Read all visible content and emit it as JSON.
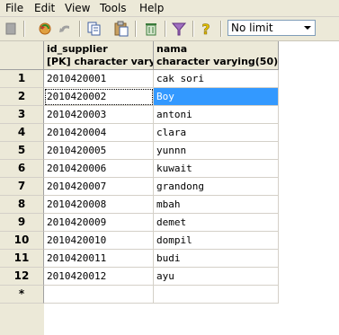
{
  "menu": [
    "File",
    "Edit",
    "View",
    "Tools",
    "Help"
  ],
  "toolbar": {
    "limit_value": "No limit"
  },
  "grid": {
    "columns": [
      {
        "name": "id_supplier",
        "type": "[PK] character varying"
      },
      {
        "name": "nama",
        "type": "character varying(50)"
      }
    ],
    "rows": [
      {
        "num": "1",
        "id": "2010420001",
        "nama": "cak sori"
      },
      {
        "num": "2",
        "id": "2010420002",
        "nama": "Boy"
      },
      {
        "num": "3",
        "id": "2010420003",
        "nama": "antoni"
      },
      {
        "num": "4",
        "id": "2010420004",
        "nama": "clara"
      },
      {
        "num": "5",
        "id": "2010420005",
        "nama": "yunnn"
      },
      {
        "num": "6",
        "id": "2010420006",
        "nama": "kuwait"
      },
      {
        "num": "7",
        "id": "2010420007",
        "nama": "grandong"
      },
      {
        "num": "8",
        "id": "2010420008",
        "nama": "mbah"
      },
      {
        "num": "9",
        "id": "2010420009",
        "nama": "demet"
      },
      {
        "num": "10",
        "id": "2010420010",
        "nama": "dompil"
      },
      {
        "num": "11",
        "id": "2010420011",
        "nama": "budi"
      },
      {
        "num": "12",
        "id": "2010420012",
        "nama": "ayu"
      }
    ],
    "new_row_marker": "*"
  },
  "colors": {
    "selection": "#3399ff"
  }
}
